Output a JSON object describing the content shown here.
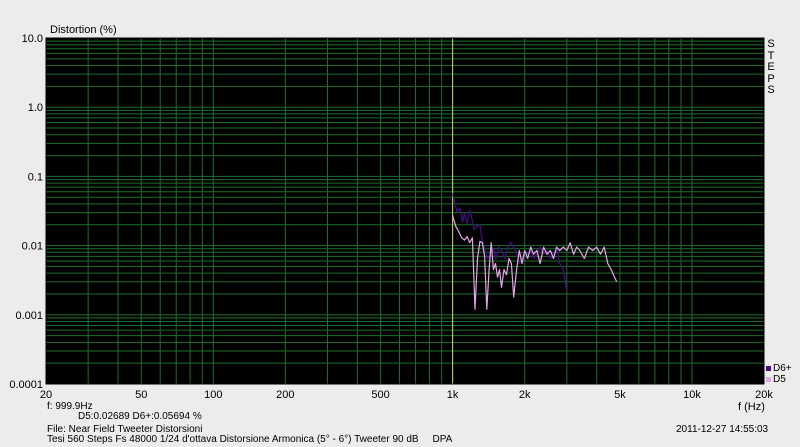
{
  "header": {
    "y_axis_title": "Distortion (%)"
  },
  "brand": {
    "letters": [
      "S",
      "T",
      "E",
      "P",
      "S"
    ]
  },
  "legend": [
    {
      "label": "D6+",
      "color": "#4b0a8c"
    },
    {
      "label": "D5",
      "color": "#e6a6e6"
    }
  ],
  "footer": {
    "cursor_freq": "f: 999.9Hz",
    "cursor_values": "D5:0.02689  D6+:0.05694 %",
    "x_unit": "f (Hz)",
    "file": "File: Near Field Tweeter Distorsioni",
    "setup": "Tesi 560 Steps Fs 48000 1/24 d'ottava Distorsione Armonica (5° - 6°) Tweeter 90 dB     DPA",
    "timestamp": "2011-12-27 14:55:03"
  },
  "colors": {
    "plot_bg": "#000000",
    "grid": "#1f6e2c",
    "cursor": "#c8d26a",
    "frame": "#000000"
  },
  "chart_data": {
    "type": "line",
    "x_scale": "log",
    "y_scale": "log",
    "xlim": [
      20,
      20000
    ],
    "ylim": [
      0.0001,
      10
    ],
    "xlabel": "f (Hz)",
    "ylabel": "Distortion (%)",
    "x_ticks": [
      20,
      50,
      100,
      200,
      500,
      1000,
      2000,
      5000,
      10000,
      20000
    ],
    "x_tick_labels": [
      "20",
      "50",
      "100",
      "200",
      "500",
      "1k",
      "2k",
      "5k",
      "10k",
      "20k"
    ],
    "y_ticks": [
      0.0001,
      0.001,
      0.01,
      0.1,
      1,
      10
    ],
    "y_tick_labels": [
      "0.0001",
      "0.001",
      "0.01",
      "0.1",
      "1.0",
      "10.0"
    ],
    "cursor_x": 999.9,
    "grid": true,
    "series": [
      {
        "name": "D6+",
        "color": "#4b0a8c",
        "points": [
          [
            1000,
            0.057
          ],
          [
            1020,
            0.041
          ],
          [
            1045,
            0.031
          ],
          [
            1070,
            0.035
          ],
          [
            1100,
            0.022
          ],
          [
            1120,
            0.029
          ],
          [
            1150,
            0.021
          ],
          [
            1175,
            0.032
          ],
          [
            1200,
            0.026
          ],
          [
            1230,
            0.017
          ],
          [
            1260,
            0.019
          ],
          [
            1300,
            0.02
          ],
          [
            1330,
            0.012
          ],
          [
            1360,
            0.009
          ],
          [
            1400,
            0.0065
          ],
          [
            1440,
            0.0075
          ],
          [
            1480,
            0.009
          ],
          [
            1520,
            0.0065
          ],
          [
            1560,
            0.0095
          ],
          [
            1600,
            0.0085
          ],
          [
            1650,
            0.0065
          ],
          [
            1700,
            0.0095
          ],
          [
            1750,
            0.011
          ],
          [
            1800,
            0.0095
          ],
          [
            1850,
            0.0075
          ],
          [
            1900,
            0.0055
          ],
          [
            1950,
            0.0065
          ],
          [
            2000,
            0.008
          ],
          [
            2060,
            0.0075
          ],
          [
            2120,
            0.0085
          ],
          [
            2180,
            0.0065
          ],
          [
            2250,
            0.0075
          ],
          [
            2320,
            0.0095
          ],
          [
            2400,
            0.0075
          ],
          [
            2480,
            0.0085
          ],
          [
            2560,
            0.0065
          ],
          [
            2640,
            0.0075
          ],
          [
            2720,
            0.0095
          ],
          [
            2800,
            0.0055
          ],
          [
            2900,
            0.0045
          ],
          [
            3000,
            0.0022
          ]
        ]
      },
      {
        "name": "D5",
        "color": "#e6a6e6",
        "points": [
          [
            1000,
            0.027
          ],
          [
            1030,
            0.019
          ],
          [
            1060,
            0.016
          ],
          [
            1090,
            0.013
          ],
          [
            1120,
            0.012
          ],
          [
            1150,
            0.0135
          ],
          [
            1180,
            0.011
          ],
          [
            1210,
            0.013
          ],
          [
            1240,
            0.0012
          ],
          [
            1270,
            0.0065
          ],
          [
            1300,
            0.0115
          ],
          [
            1330,
            0.011
          ],
          [
            1360,
            0.007
          ],
          [
            1390,
            0.0012
          ],
          [
            1420,
            0.0045
          ],
          [
            1450,
            0.011
          ],
          [
            1480,
            0.0045
          ],
          [
            1510,
            0.0055
          ],
          [
            1540,
            0.0035
          ],
          [
            1570,
            0.0045
          ],
          [
            1600,
            0.0025
          ],
          [
            1640,
            0.0045
          ],
          [
            1680,
            0.0038
          ],
          [
            1720,
            0.0065
          ],
          [
            1760,
            0.0055
          ],
          [
            1800,
            0.0018
          ],
          [
            1850,
            0.0045
          ],
          [
            1900,
            0.0085
          ],
          [
            1950,
            0.0055
          ],
          [
            2000,
            0.0085
          ],
          [
            2060,
            0.0065
          ],
          [
            2120,
            0.0095
          ],
          [
            2180,
            0.0075
          ],
          [
            2250,
            0.0085
          ],
          [
            2320,
            0.0055
          ],
          [
            2400,
            0.0095
          ],
          [
            2480,
            0.0075
          ],
          [
            2560,
            0.0085
          ],
          [
            2640,
            0.0065
          ],
          [
            2720,
            0.0095
          ],
          [
            2800,
            0.0085
          ],
          [
            2900,
            0.0095
          ],
          [
            3000,
            0.0085
          ],
          [
            3100,
            0.011
          ],
          [
            3200,
            0.0075
          ],
          [
            3300,
            0.0095
          ],
          [
            3400,
            0.0085
          ],
          [
            3550,
            0.0065
          ],
          [
            3700,
            0.0095
          ],
          [
            3850,
            0.0085
          ],
          [
            4000,
            0.0095
          ],
          [
            4150,
            0.0075
          ],
          [
            4300,
            0.0095
          ],
          [
            4450,
            0.0055
          ],
          [
            4600,
            0.0045
          ],
          [
            4750,
            0.0035
          ],
          [
            4850,
            0.003
          ]
        ]
      }
    ]
  }
}
